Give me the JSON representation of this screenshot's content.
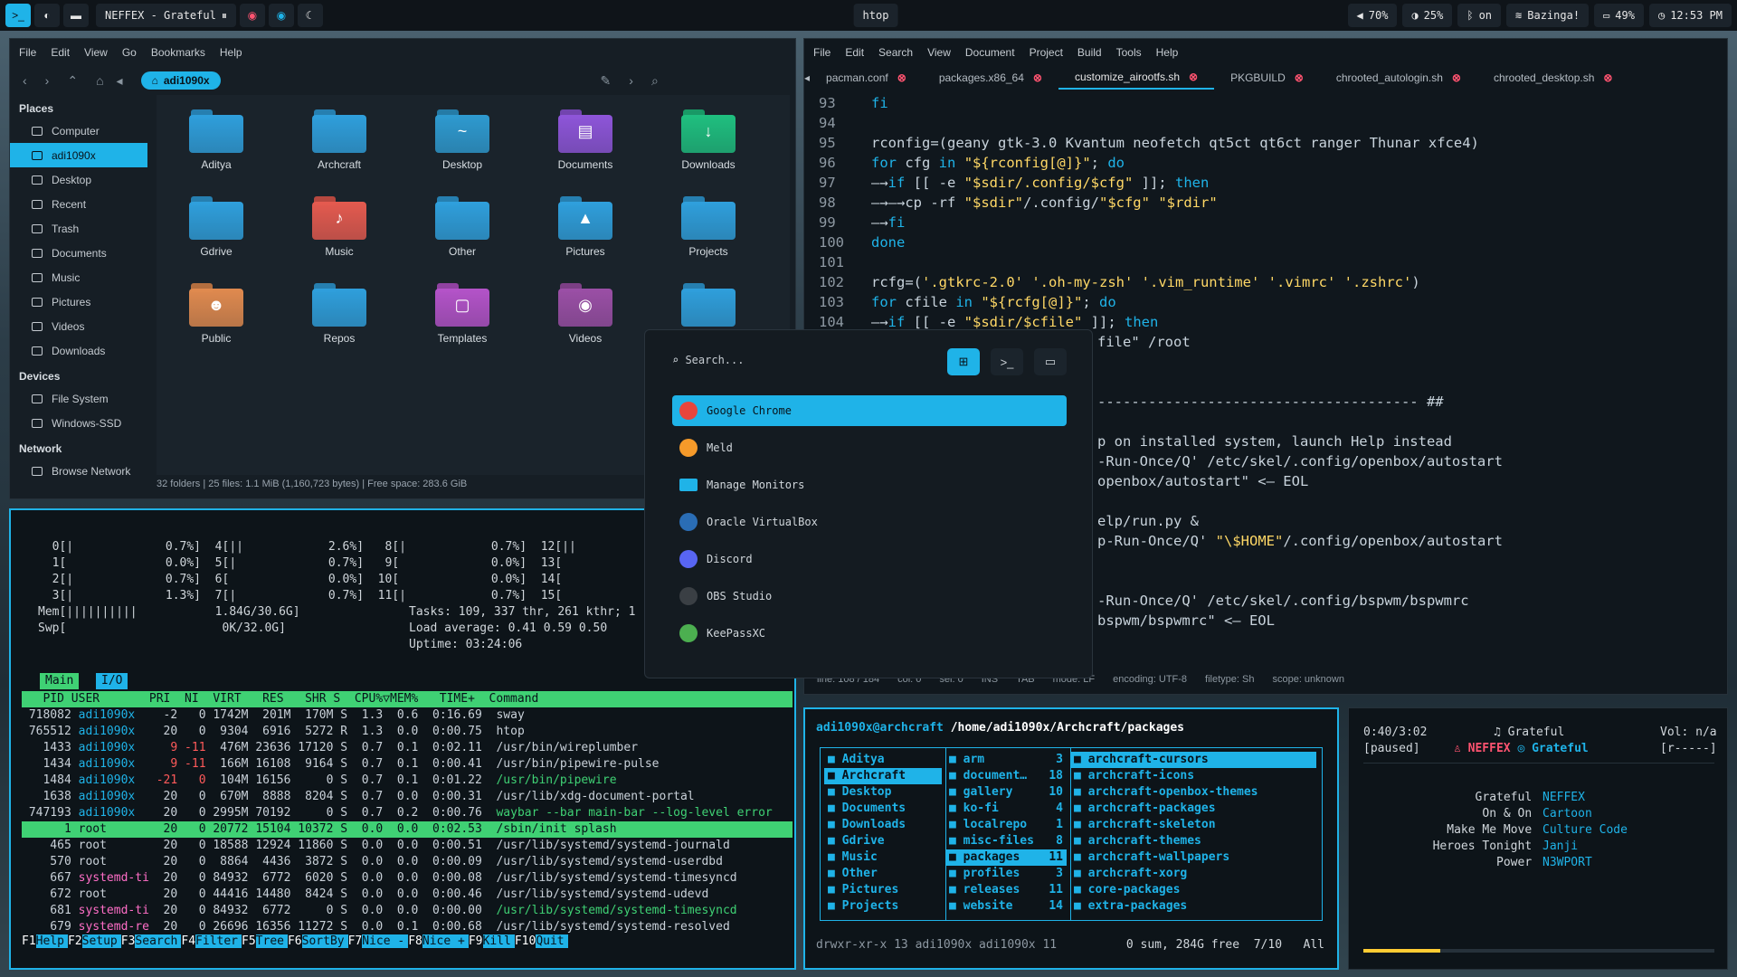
{
  "topbar": {
    "title": "htop",
    "now_playing": "NEFFEX - Grateful",
    "volume": "70%",
    "brightness": "25%",
    "bluetooth": "on",
    "wifi": "Bazinga!",
    "battery": "49%",
    "clock": "12:53 PM"
  },
  "colors": {
    "accent": "#1fb3e8",
    "green": "#3fd174",
    "red": "#ff5370"
  },
  "fm": {
    "menu": [
      "File",
      "Edit",
      "View",
      "Go",
      "Bookmarks",
      "Help"
    ],
    "path": "adi1090x",
    "places_h": "Places",
    "places": [
      "Computer",
      "adi1090x",
      "Desktop",
      "Recent",
      "Trash",
      "Documents",
      "Music",
      "Pictures",
      "Videos",
      "Downloads"
    ],
    "devices_h": "Devices",
    "devices": [
      "File System",
      "Windows-SSD"
    ],
    "network_h": "Network",
    "network": [
      "Browse Network"
    ],
    "folders": [
      "Aditya",
      "Archcraft",
      "Desktop",
      "Documents",
      "Downloads",
      "Gdrive",
      "Music",
      "Other",
      "Pictures",
      "Projects",
      "Public",
      "Repos",
      "Templates",
      "Videos",
      ""
    ],
    "status": "32 folders  |  25 files: 1.1 MiB (1,160,723 bytes)  |  Free space: 283.6 GiB"
  },
  "editor": {
    "menu": [
      "File",
      "Edit",
      "Search",
      "View",
      "Document",
      "Project",
      "Build",
      "Tools",
      "Help"
    ],
    "tabs": [
      "pacman.conf",
      "packages.x86_64",
      "customize_airootfs.sh",
      "PKGBUILD",
      "chrooted_autologin.sh",
      "chrooted_desktop.sh"
    ],
    "line_numbers": [
      "93",
      "94",
      "95",
      "96",
      "97",
      "98",
      "99",
      "100",
      "101",
      "102",
      "103",
      "104"
    ],
    "lines": [
      "fi",
      "",
      "rconfig=(geany gtk-3.0 Kvantum neofetch qt5ct qt6ct ranger Thunar xfce4)",
      "for cfg in \"${rconfig[@]}\"; do",
      "—→if [[ -e \"$sdir/.config/$cfg\" ]]; then",
      "—→—→cp -rf \"$sdir\"/.config/\"$cfg\" \"$rdir\"",
      "—→fi",
      "done",
      "",
      "rcfg=('.gtkrc-2.0' '.oh-my-zsh' '.vim_runtime' '.vimrc' '.zshrc')",
      "for cfile in \"${rcfg[@]}\"; do",
      "—→if [[ -e \"$sdir/$cfile\" ]]; then"
    ],
    "right_lines": [
      "file\" /root",
      "",
      "",
      "-------------------------------------- ##",
      "",
      "p on installed system, launch Help instead",
      "-Run-Once/Q' /etc/skel/.config/openbox/autostart",
      "openbox/autostart\" <— EOL",
      "",
      "elp/run.py &",
      "p-Run-Once/Q' \"\\$HOME\"/.config/openbox/autostart",
      "",
      "",
      "-Run-Once/Q' /etc/skel/.config/bspwm/bspwmrc",
      "bspwm/bspwmrc\" <— EOL"
    ],
    "status": [
      "line: 108 / 184",
      "col: 0",
      "sel: 0",
      "INS",
      "TAB",
      "mode: LF",
      "encoding: UTF-8",
      "filetype: Sh",
      "scope: unknown"
    ]
  },
  "htop": {
    "cpu": [
      "  0[|             0.7%]  4[||            2.6%]   8[|            0.7%]  12[||",
      "  1[              0.0%]  5[|             0.7%]   9[             0.0%]  13[",
      "  2[|             0.7%]  6[              0.0%]  10[             0.0%]  14[",
      "  3[|             1.3%]  7[|             0.7%]  11[|            0.7%]  15["
    ],
    "mem": "Mem[||||||||||           1.84G/30.6G]",
    "swp": "Swp[                      0K/32.0G]",
    "tasks": "Tasks: 109, 337 thr, 261 kthr; 1",
    "load": "Load average: 0.41 0.59 0.50",
    "uptime": "Uptime: 03:24:06",
    "tabs": [
      "Main",
      "I/O"
    ],
    "header": "   PID USER       PRI  NI  VIRT   RES   SHR S  CPU%▽MEM%   TIME+  Command",
    "rows": [
      [
        "718082",
        "adi1090x",
        "-2",
        "0",
        "1742M",
        "201M",
        "170M",
        "S",
        "1.3",
        "0.6",
        "0:16.69",
        "sway"
      ],
      [
        "765512",
        "adi1090x",
        "20",
        "0",
        "9304",
        "6916",
        "5272",
        "R",
        "1.3",
        "0.0",
        "0:00.75",
        "htop"
      ],
      [
        "1433",
        "adi1090x",
        "9",
        "-11",
        "476M",
        "23636",
        "17120",
        "S",
        "0.7",
        "0.1",
        "0:02.11",
        "/usr/bin/wireplumber"
      ],
      [
        "1434",
        "adi1090x",
        "9",
        "-11",
        "166M",
        "16108",
        "9164",
        "S",
        "0.7",
        "0.1",
        "0:00.41",
        "/usr/bin/pipewire-pulse"
      ],
      [
        "1484",
        "adi1090x",
        "-21",
        "0",
        "104M",
        "16156",
        "0",
        "S",
        "0.7",
        "0.1",
        "0:01.22",
        "/usr/bin/pipewire"
      ],
      [
        "1638",
        "adi1090x",
        "20",
        "0",
        "670M",
        "8888",
        "8204",
        "S",
        "0.7",
        "0.0",
        "0:00.31",
        "/usr/lib/xdg-document-portal"
      ],
      [
        "747193",
        "adi1090x",
        "20",
        "0",
        "2995M",
        "70192",
        "0",
        "S",
        "0.7",
        "0.2",
        "0:00.76",
        "waybar --bar main-bar --log-level error"
      ],
      [
        "1",
        "root",
        "20",
        "0",
        "20772",
        "15104",
        "10372",
        "S",
        "0.0",
        "0.0",
        "0:02.53",
        "/sbin/init splash"
      ],
      [
        "465",
        "root",
        "20",
        "0",
        "18588",
        "12924",
        "11860",
        "S",
        "0.0",
        "0.0",
        "0:00.51",
        "/usr/lib/systemd/systemd-journald"
      ],
      [
        "570",
        "root",
        "20",
        "0",
        "8864",
        "4436",
        "3872",
        "S",
        "0.0",
        "0.0",
        "0:00.09",
        "/usr/lib/systemd/systemd-userdbd"
      ],
      [
        "667",
        "systemd-ti",
        "20",
        "0",
        "84932",
        "6772",
        "6020",
        "S",
        "0.0",
        "0.0",
        "0:00.08",
        "/usr/lib/systemd/systemd-timesyncd"
      ],
      [
        "672",
        "root",
        "20",
        "0",
        "44416",
        "14480",
        "8424",
        "S",
        "0.0",
        "0.0",
        "0:00.46",
        "/usr/lib/systemd/systemd-udevd"
      ],
      [
        "681",
        "systemd-ti",
        "20",
        "0",
        "84932",
        "6772",
        "0",
        "S",
        "0.0",
        "0.0",
        "0:00.00",
        "/usr/lib/systemd/systemd-timesyncd"
      ],
      [
        "679",
        "systemd-re",
        "20",
        "0",
        "26696",
        "16356",
        "11272",
        "S",
        "0.0",
        "0.1",
        "0:00.68",
        "/usr/lib/systemd/systemd-resolved"
      ]
    ],
    "keys": [
      [
        "F1",
        "Help"
      ],
      [
        "F2",
        "Setup"
      ],
      [
        "F3",
        "Search"
      ],
      [
        "F4",
        "Filter"
      ],
      [
        "F5",
        "Tree"
      ],
      [
        "F6",
        "SortBy"
      ],
      [
        "F7",
        "Nice -"
      ],
      [
        "F8",
        "Nice +"
      ],
      [
        "F9",
        "Kill"
      ],
      [
        "F10",
        "Quit"
      ]
    ]
  },
  "ranger": {
    "title": "adi1090x@archcraft",
    "path": "/home/adi1090x/Archcraft/packages",
    "col1": [
      "Aditya",
      "Archcraft",
      "Desktop",
      "Documents",
      "Downloads",
      "Gdrive",
      "Music",
      "Other",
      "Pictures",
      "Projects"
    ],
    "col2": [
      [
        "arm",
        "3"
      ],
      [
        "document…",
        "18"
      ],
      [
        "gallery",
        "10"
      ],
      [
        "ko-fi",
        "4"
      ],
      [
        "localrepo",
        "1"
      ],
      [
        "misc-files",
        "8"
      ],
      [
        "packages",
        "11"
      ],
      [
        "profiles",
        "3"
      ],
      [
        "releases",
        "11"
      ],
      [
        "website",
        "14"
      ]
    ],
    "col3": [
      "archcraft-cursors",
      "archcraft-icons",
      "archcraft-openbox-themes",
      "archcraft-packages",
      "archcraft-skeleton",
      "archcraft-themes",
      "archcraft-wallpapers",
      "archcraft-xorg",
      "core-packages",
      "extra-packages"
    ],
    "status_left": "drwxr-xr-x 13 adi1090x adi1090x 11",
    "status_right": "0 sum, 284G free  7/10   All"
  },
  "music": {
    "time": "0:40/3:02",
    "state": "[paused]",
    "song": "Grateful",
    "artist": "NEFFEX",
    "album": "Grateful",
    "vol": "Vol: n/a",
    "flags": "[r-----]",
    "list": [
      [
        "Grateful",
        "NEFFEX"
      ],
      [
        "On & On",
        "Cartoon"
      ],
      [
        "Make Me Move",
        "Culture Code"
      ],
      [
        "Heroes Tonight",
        "Janji"
      ],
      [
        "Power",
        "N3WPORT"
      ]
    ],
    "progress": 0.22
  },
  "launcher": {
    "placeholder": "Search...",
    "items": [
      "Google Chrome",
      "Meld",
      "Manage Monitors",
      "Oracle VirtualBox",
      "Discord",
      "OBS Studio",
      "KeePassXC"
    ]
  }
}
